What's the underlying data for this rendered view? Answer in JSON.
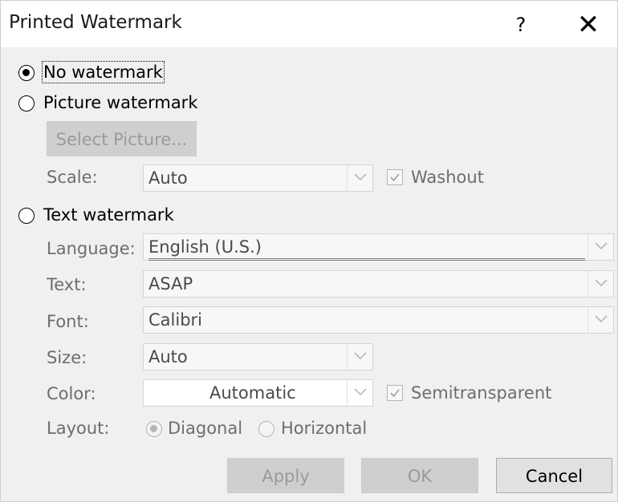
{
  "dialog": {
    "title": "Printed Watermark",
    "help_label": "?",
    "close_label": "✕"
  },
  "options": {
    "no_watermark": "No watermark",
    "picture_watermark": "Picture watermark",
    "text_watermark": "Text watermark",
    "selected": "no_watermark"
  },
  "picture": {
    "select_button": "Select Picture...",
    "scale_label": "Scale:",
    "scale_value": "Auto",
    "washout_label": "Washout",
    "washout_checked": true
  },
  "text": {
    "language_label": "Language:",
    "language_value": "English (U.S.)",
    "text_label": "Text:",
    "text_value": "ASAP",
    "font_label": "Font:",
    "font_value": "Calibri",
    "size_label": "Size:",
    "size_value": "Auto",
    "color_label": "Color:",
    "color_value": "Automatic",
    "semitransparent_label": "Semitransparent",
    "semitransparent_checked": true,
    "layout_label": "Layout:",
    "layout_diagonal": "Diagonal",
    "layout_horizontal": "Horizontal",
    "layout_selected": "diagonal"
  },
  "buttons": {
    "apply": "Apply",
    "ok": "OK",
    "cancel": "Cancel"
  },
  "icons": {
    "close": "close-icon",
    "help": "help-icon",
    "dropdown": "chevron-down-icon",
    "check": "checkmark-icon"
  }
}
